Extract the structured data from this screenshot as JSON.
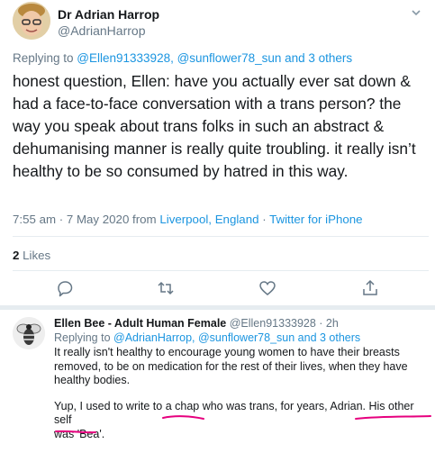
{
  "tweet": {
    "author_name": "Dr Adrian Harrop",
    "author_handle": "@AdrianHarrop",
    "replying_prefix": "Replying to ",
    "replying_mentions": "@Ellen91333928, @sunflower78_sun and 3 others",
    "body": "honest question, Ellen: have you actually ever sat down & had a face-to-face conversation with a trans person? the way you speak about trans folks in such an abstract & dehumanising manner is really quite troubling. it really isn’t healthy to be so consumed by hatred in this way.",
    "timestamp": "7:55 am · 7 May 2020 from ",
    "location": "Liverpool, England",
    "separator": " · ",
    "source": "Twitter for iPhone",
    "likes_count": "2",
    "likes_label": " Likes"
  },
  "actions": {
    "reply_icon": "reply-icon",
    "retweet_icon": "retweet-icon",
    "like_icon": "heart-icon",
    "share_icon": "share-icon"
  },
  "reply": {
    "author_name": "Ellen Bee - Adult Human Female",
    "author_handle": " @Ellen91333928 · 2h",
    "replying_prefix": "Replying to ",
    "replying_mentions": "@AdrianHarrop, @sunflower78_sun and 3 others",
    "paragraph1": "It really isn't healthy to encourage young women to have their breasts removed, to be on medication for the rest of their lives, when they have healthy bodies.",
    "p2_before": "Yup, I used to write to ",
    "p2_highlight1": "a chap",
    "p2_middle": " who was trans, for years, Adrian.  ",
    "p2_highlight2": "His other self",
    "p2_break": " was ",
    "p2_highlight3": "'Bea'",
    "p2_end": "."
  },
  "colors": {
    "link": "#1b95e0",
    "muted": "#657786",
    "annotation": "#e6007e"
  }
}
